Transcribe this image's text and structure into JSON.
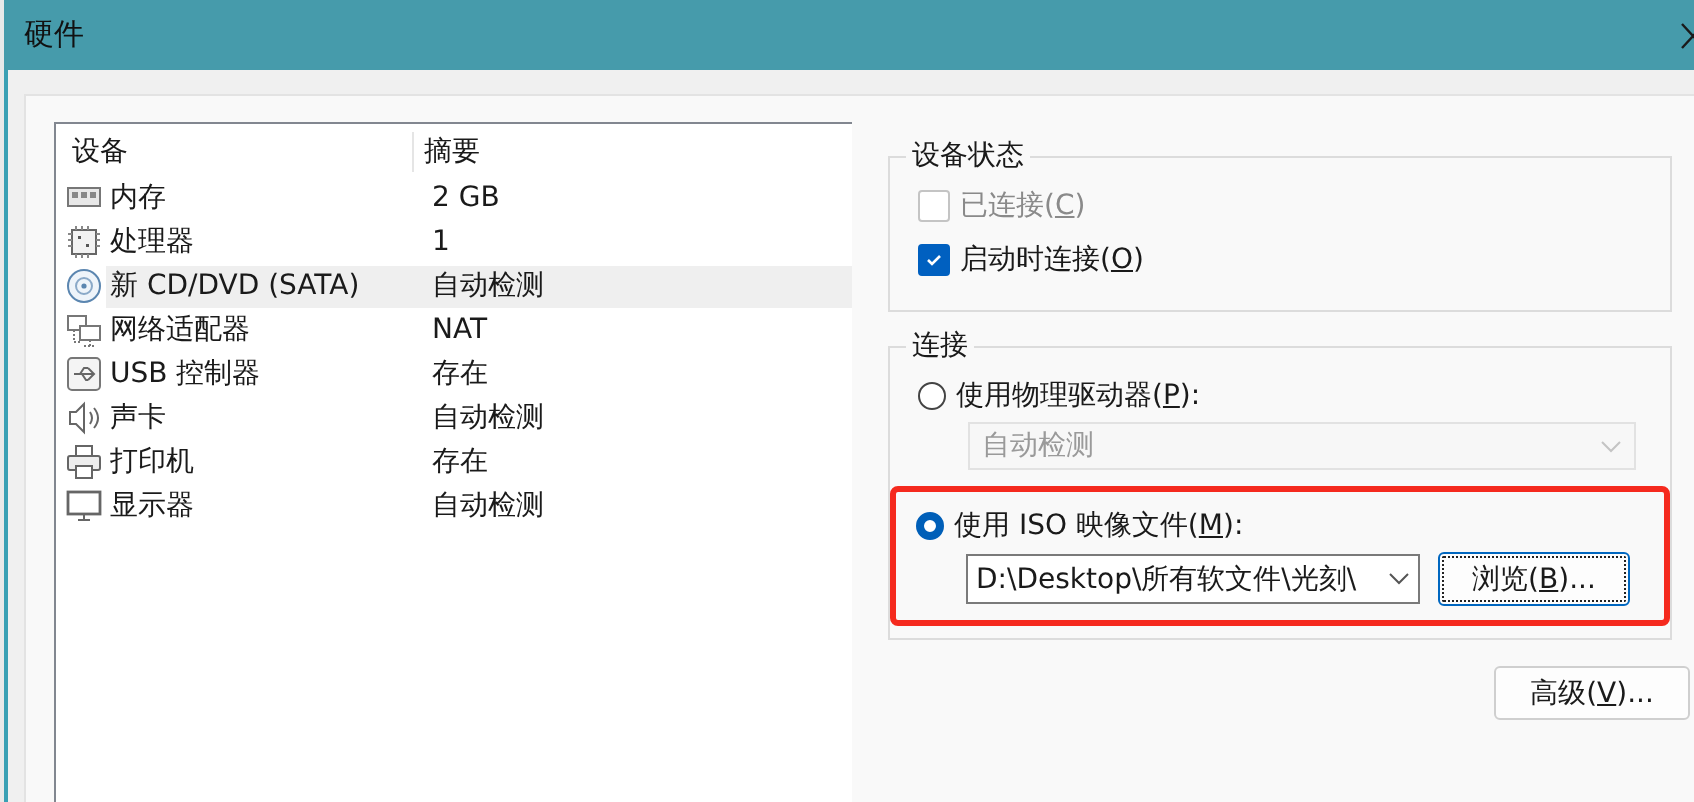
{
  "window": {
    "title": "硬件"
  },
  "device_list": {
    "columns": [
      "设备",
      "摘要"
    ],
    "rows": [
      {
        "kind": "memory",
        "name": "内存",
        "summary": "2 GB",
        "selected": false
      },
      {
        "kind": "cpu",
        "name": "处理器",
        "summary": "1",
        "selected": false
      },
      {
        "kind": "disc",
        "name": "新 CD/DVD (SATA)",
        "summary": "自动检测",
        "selected": true
      },
      {
        "kind": "network",
        "name": "网络适配器",
        "summary": "NAT",
        "selected": false
      },
      {
        "kind": "usb",
        "name": "USB 控制器",
        "summary": "存在",
        "selected": false
      },
      {
        "kind": "speaker",
        "name": "声卡",
        "summary": "自动检测",
        "selected": false
      },
      {
        "kind": "printer",
        "name": "打印机",
        "summary": "存在",
        "selected": false
      },
      {
        "kind": "monitor",
        "name": "显示器",
        "summary": "自动检测",
        "selected": false
      }
    ]
  },
  "device_status": {
    "title": "设备状态",
    "options": [
      {
        "before": "已连接(",
        "key": "C",
        "after": ")",
        "checked": false,
        "disabled": true
      },
      {
        "before": "启动时连接(",
        "key": "O",
        "after": ")",
        "checked": true,
        "disabled": false
      }
    ]
  },
  "connection": {
    "title": "连接",
    "options": [
      {
        "kind": "drive",
        "before": "使用物理驱动器(",
        "key": "P",
        "after": "):",
        "selected": false,
        "highlighted": false,
        "dropdown": {
          "value": "自动检测",
          "disabled": true
        }
      },
      {
        "kind": "iso",
        "before": "使用 ISO 映像文件(",
        "key": "M",
        "after": "):",
        "selected": true,
        "highlighted": true,
        "path": "D:\\Desktop\\所有软文件\\光刻\\",
        "browse": {
          "before": "浏览(",
          "key": "B",
          "after": ")...",
          "focused": true
        }
      }
    ]
  },
  "advanced_button": {
    "before": "高级(",
    "key": "V",
    "after": ")..."
  }
}
